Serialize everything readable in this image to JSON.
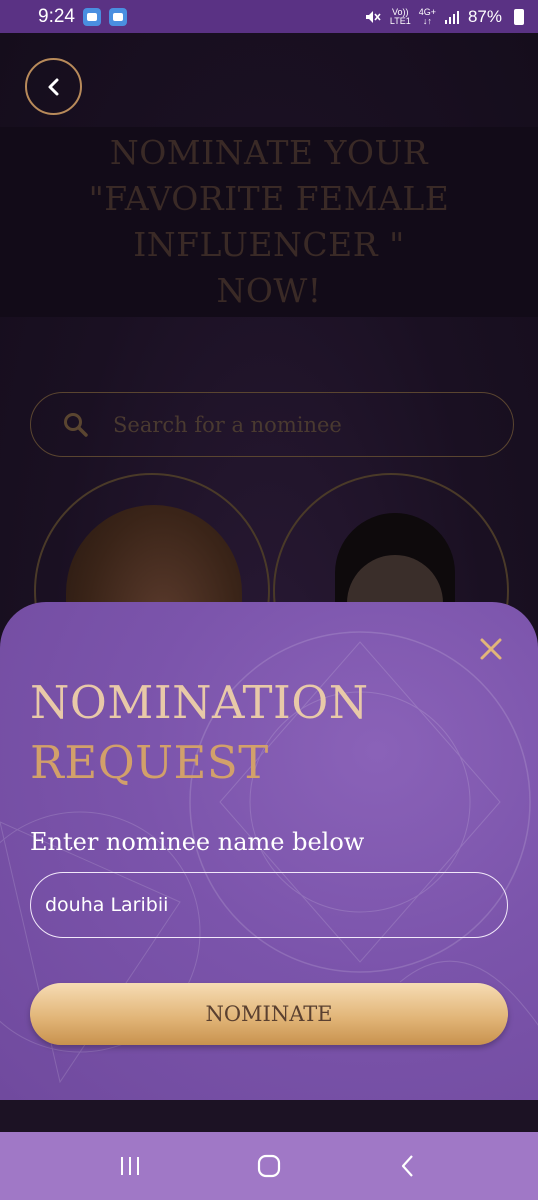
{
  "status_bar": {
    "time": "9:24",
    "network_top": "Vo))",
    "network_bottom": "LTE1",
    "data_top": "4G+",
    "data_bottom": "↓↑",
    "battery": "87%"
  },
  "background_page": {
    "banner_title": "NOMINATE YOUR \"FAVORITE FEMALE INFLUENCER \" NOW!",
    "search_placeholder": "Search for a nominee"
  },
  "modal": {
    "title_line1": "NOMINATION",
    "title_line2": "REQUEST",
    "field_label": "Enter nominee name below",
    "name_value": "douha Laribii",
    "submit_label": "NOMINATE"
  },
  "colors": {
    "sheet": "#7b54ab",
    "title_light": "#e8c9a8",
    "title_gold": "#d2a06a",
    "button_gold": "#e2b679",
    "nav_bar": "#a078c6",
    "status_bar": "#5a3284"
  },
  "icons": {
    "back": "chevron-left-icon",
    "search": "search-icon",
    "close": "close-icon",
    "recents": "recents-icon",
    "home": "home-icon",
    "nav_back": "back-icon"
  }
}
